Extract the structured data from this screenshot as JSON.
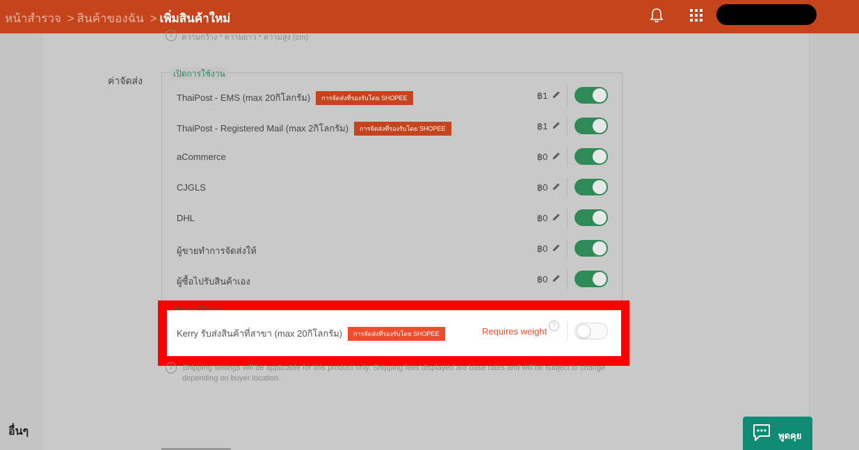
{
  "header": {
    "crumb_home": "หน้าสำรวจ",
    "crumb_products": "สินค้าของฉัน",
    "crumb_current": "เพิ่มสินค้าใหม่",
    "separator": ">"
  },
  "dimension_hint": "ความกว้าง * ความยาว * ความสูง (cm)",
  "shipping_label": "ค่าจัดส่ง",
  "enabled_legend": "เปิดการใช้งาน",
  "disabled_legend": "ปิดการใช้งาน",
  "badge_text": "การจัดส่งที่รองรับโดย SHOPEE",
  "channels": [
    {
      "name": "ThaiPost - EMS (max 20กิโลกรัม)",
      "price": "฿1",
      "badge": true,
      "enabled": true
    },
    {
      "name": "ThaiPost - Registered Mail (max 2กิโลกรัม)",
      "price": "฿1",
      "badge": true,
      "enabled": true
    },
    {
      "name": "aCommerce",
      "price": "฿0",
      "badge": false,
      "enabled": true
    },
    {
      "name": "CJGLS",
      "price": "฿0",
      "badge": false,
      "enabled": true
    },
    {
      "name": "DHL",
      "price": "฿0",
      "badge": false,
      "enabled": true
    },
    {
      "name": "ผู้ขายทำการจัดส่งให้",
      "price": "฿0",
      "badge": false,
      "enabled": true
    },
    {
      "name": "ผู้ซื้อไปรับสินค้าเอง",
      "price": "฿0",
      "badge": false,
      "enabled": true
    }
  ],
  "disabled_channel": {
    "name": "Kerry รับส่งสินค้าที่สาขา (max 20กิโลกรัม)",
    "requires": "Requires weight",
    "enabled": false
  },
  "notice": "Shipping settings will be applicable for this product only. Shipping fees displayed are base rates and will be subject to change depending on buyer location.",
  "other_section": "อื่นๆ",
  "chat_label": "พูดคุย",
  "colors": {
    "header": "#c5441b",
    "toggle_on": "#2e8b57",
    "badge": "#ee4d2d",
    "highlight": "#ff0000",
    "chat": "#0f8a73"
  },
  "icons": {
    "bell": "bell-icon",
    "apps": "grid-icon",
    "edit": "pencil-icon",
    "help": "question-icon",
    "info": "info-icon",
    "chat": "chat-icon"
  }
}
